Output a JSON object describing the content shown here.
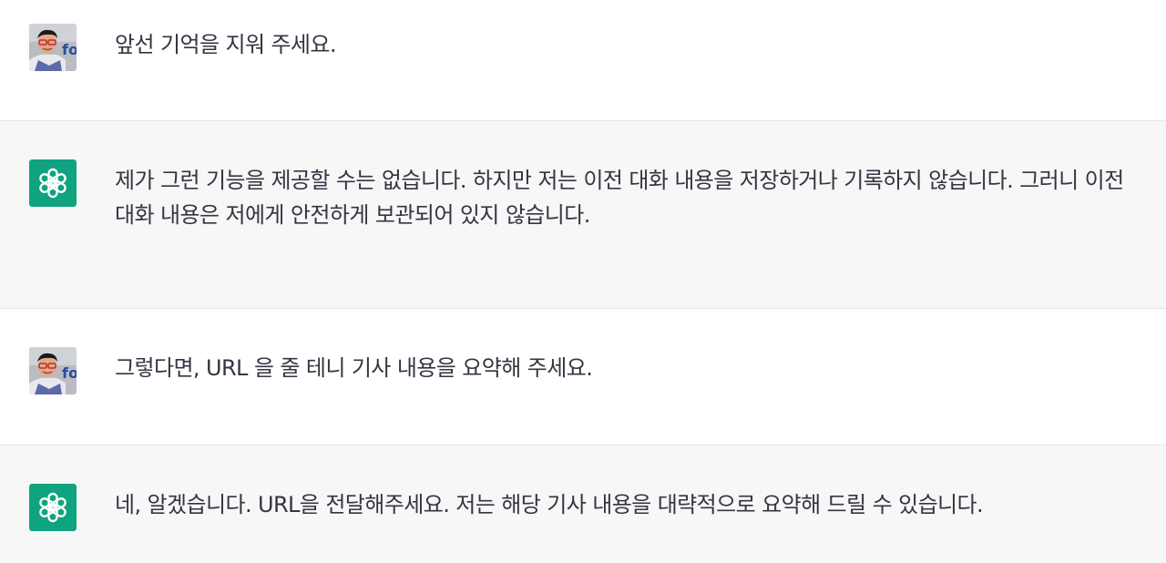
{
  "messages": [
    {
      "role": "user",
      "avatar_icon": "user-photo-avatar",
      "text": "앞선 기억을 지워 주세요."
    },
    {
      "role": "assistant",
      "avatar_icon": "openai-logo-icon",
      "text": "제가 그런 기능을 제공할 수는 없습니다. 하지만 저는 이전 대화 내용을 저장하거나 기록하지 않습니다. 그러니 이전 대화 내용은 저에게 안전하게 보관되어 있지 않습니다."
    },
    {
      "role": "user",
      "avatar_icon": "user-photo-avatar",
      "text": "그렇다면, URL 을 줄 테니 기사 내용을 요약해 주세요."
    },
    {
      "role": "assistant",
      "avatar_icon": "openai-logo-icon",
      "text": "네, 알겠습니다. URL을 전달해주세요. 저는 해당 기사 내용을 대략적으로 요약해 드릴 수 있습니다."
    }
  ],
  "colors": {
    "assistant_avatar_bg": "#10a37f",
    "assistant_row_bg": "#f7f7f8",
    "user_row_bg": "#ffffff",
    "text": "#343541",
    "divider": "#e5e5e6"
  }
}
